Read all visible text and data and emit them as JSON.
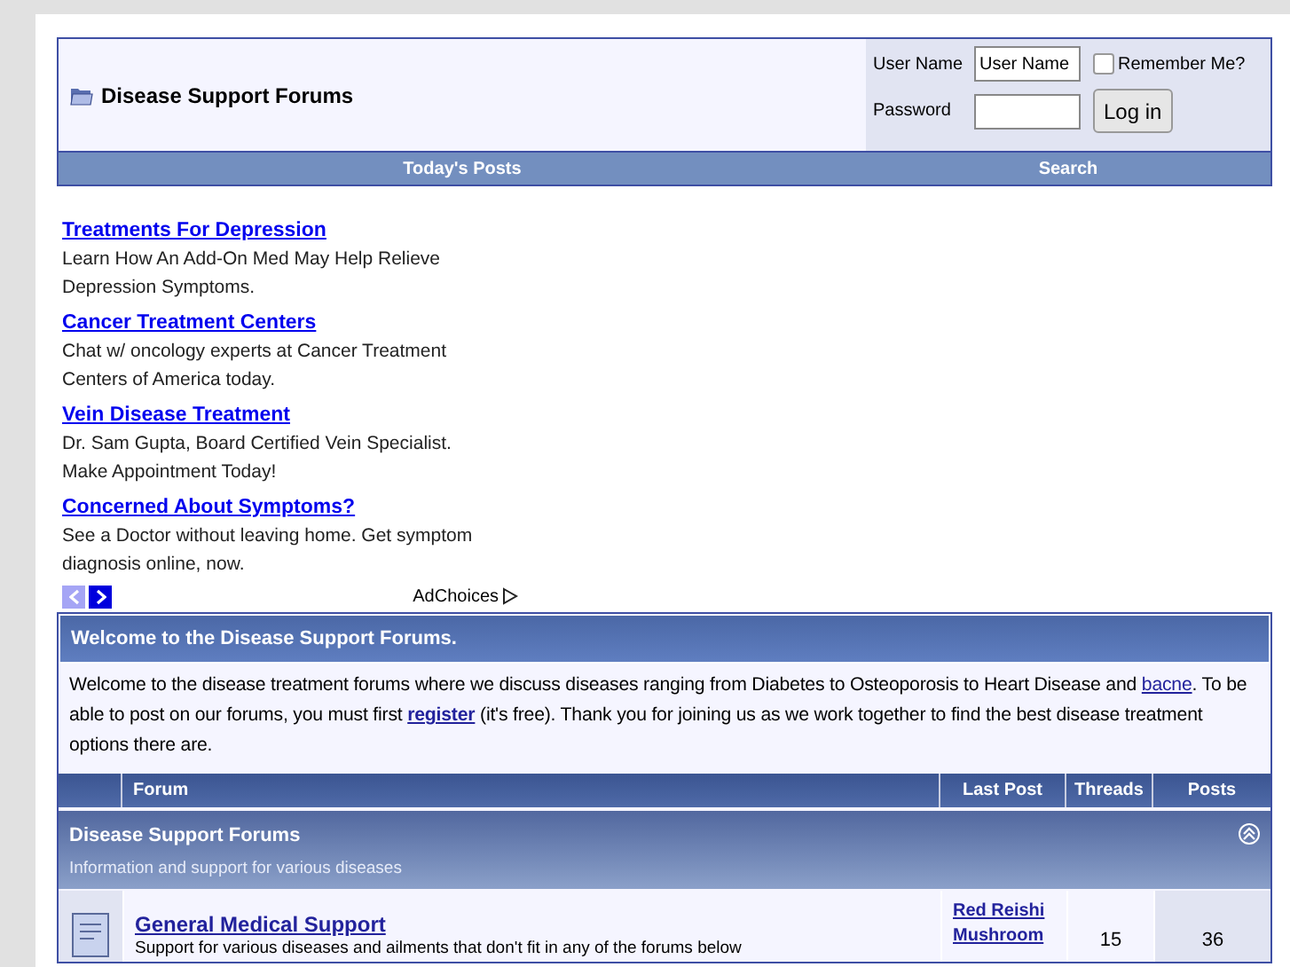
{
  "header": {
    "title": "Disease Support Forums",
    "login": {
      "username_label": "User Name",
      "username_value": "User Name",
      "remember_label": "Remember Me?",
      "remember_checked": false,
      "password_label": "Password",
      "button": "Log in"
    }
  },
  "navbar": [
    "Today's Posts",
    "Search"
  ],
  "ads": [
    {
      "title": "Treatments For Depression",
      "text": "Learn How An Add-On Med May Help Relieve Depression Symptoms."
    },
    {
      "title": "Cancer Treatment Centers",
      "text": "Chat w/ oncology experts at Cancer Treatment Centers of America today."
    },
    {
      "title": "Vein Disease Treatment",
      "text": "Dr. Sam Gupta, Board Certified Vein Specialist. Make Appointment Today!"
    },
    {
      "title": "Concerned About Symptoms?",
      "text": "See a Doctor without leaving home. Get symptom diagnosis online, now."
    }
  ],
  "ad_nav": {
    "prev_disabled": true,
    "adchoices": "AdChoices"
  },
  "welcome": {
    "title": "Welcome to the Disease Support Forums.",
    "before": "Welcome to the disease treatment forums where we discuss diseases ranging from Diabetes to Osteoporosis to Heart Disease and",
    "link1": "bacne",
    "middle": ". To be able to post on our forums, you must first",
    "link2": "register",
    "after": "(it's free). Thank you for joining us as we work together to find the best disease treatment options there are."
  },
  "table": {
    "columns": [
      "Forum",
      "Last Post",
      "Threads",
      "Posts"
    ],
    "category": {
      "title": "Disease Support Forums",
      "description": "Information and support for various diseases",
      "expanded": true
    },
    "rows": [
      {
        "name": "General Medical Support",
        "description": "Support for various diseases and ailments that don't fit in any of the forums below",
        "last_post": "Red Reishi Mushroom",
        "threads": "15",
        "posts": "36"
      }
    ]
  }
}
